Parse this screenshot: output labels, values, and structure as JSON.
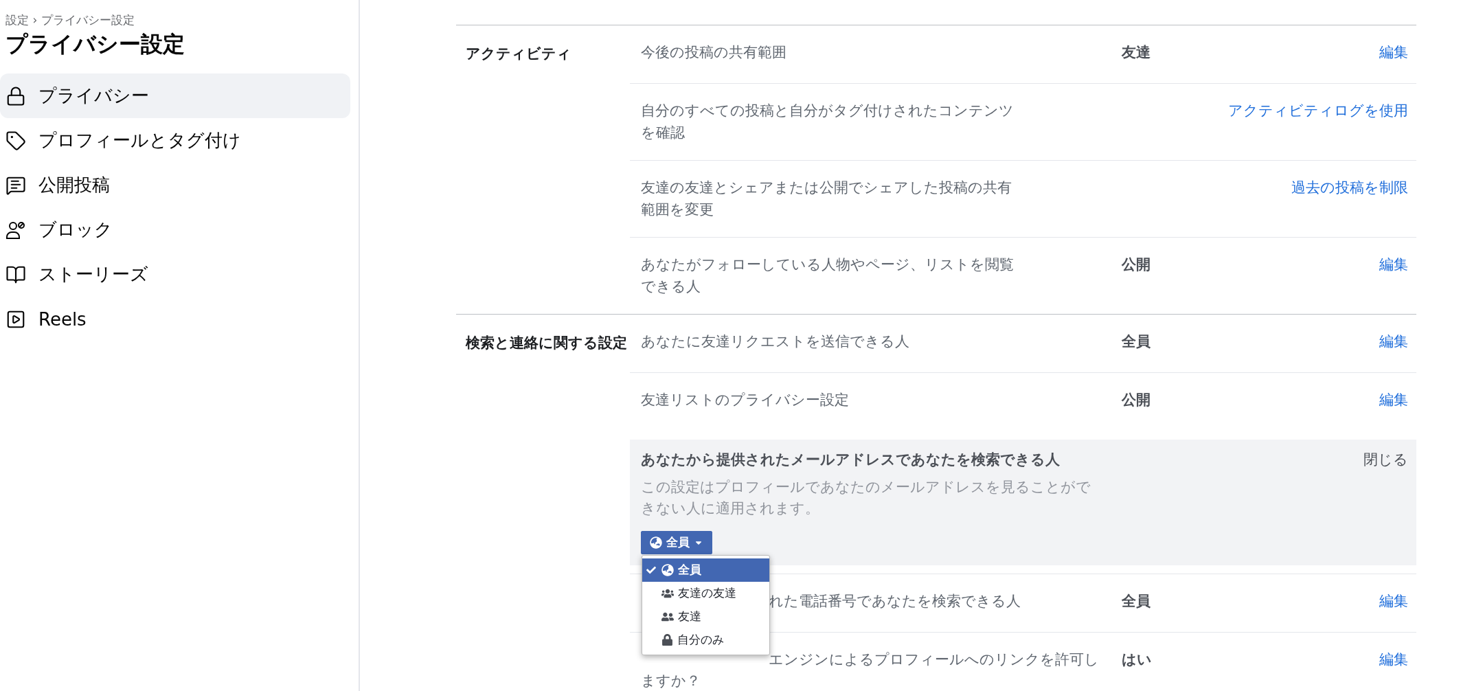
{
  "breadcrumb": "設定 › プライバシー設定",
  "page_title": "プライバシー設定",
  "sidebar": {
    "items": [
      {
        "label": "プライバシー",
        "selected": true
      },
      {
        "label": "プロフィールとタグ付け",
        "selected": false
      },
      {
        "label": "公開投稿",
        "selected": false
      },
      {
        "label": "ブロック",
        "selected": false
      },
      {
        "label": "ストーリーズ",
        "selected": false
      },
      {
        "label": "Reels",
        "selected": false
      }
    ]
  },
  "sections": [
    {
      "title": "アクティビティ",
      "rows": [
        {
          "kind": "setting",
          "label": "今後の投稿の共有範囲",
          "value": "友達",
          "action": "編集"
        },
        {
          "kind": "setting",
          "label": "自分のすべての投稿と自分がタグ付けされたコンテンツを確認",
          "action": "アクティビティログを使用"
        },
        {
          "kind": "setting",
          "label": "友達の友達とシェアまたは公開でシェアした投稿の共有範囲を変更",
          "action": "過去の投稿を制限"
        },
        {
          "kind": "setting",
          "label": "あなたがフォローしている人物やページ、リストを閲覧できる人",
          "value": "公開",
          "action": "編集"
        }
      ]
    },
    {
      "title": "検索と連絡に関する設定",
      "rows": [
        {
          "kind": "setting",
          "label": "あなたに友達リクエストを送信できる人",
          "value": "全員",
          "action": "編集"
        },
        {
          "kind": "setting",
          "label": "友達リストのプライバシー設定",
          "value": "公開",
          "action": "編集"
        },
        {
          "kind": "expanded",
          "label": "あなたから提供されたメールアドレスであなたを検索できる人",
          "description": "この設定はプロフィールであなたのメールアドレスを見ることができない人に適用されます。",
          "action": "閉じる",
          "dropdown": {
            "value": "全員",
            "options": [
              {
                "label": "全員",
                "selected": true
              },
              {
                "label": "友達の友達",
                "selected": false
              },
              {
                "label": "友達",
                "selected": false
              },
              {
                "label": "自分のみ",
                "selected": false
              }
            ]
          }
        },
        {
          "kind": "covered",
          "label": "れた電話番号であなたを検索できる人",
          "value": "全員",
          "action": "編集"
        },
        {
          "kind": "covered",
          "label": "エンジンによるプロフィールへのリンクを許可し",
          "label_cont": "ますか？",
          "value": "はい",
          "action": "編集"
        }
      ]
    }
  ]
}
